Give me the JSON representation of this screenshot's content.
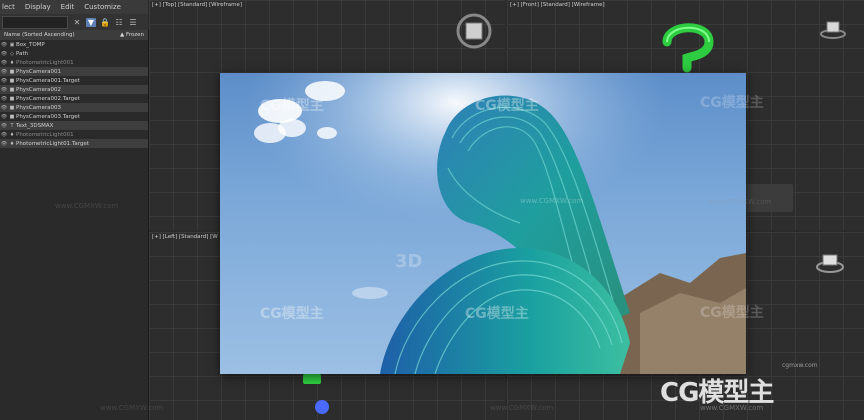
{
  "menu": [
    "lect",
    "Display",
    "Edit",
    "Customize"
  ],
  "explorer": {
    "header_name": "Name (Sorted Ascending)",
    "header_frozen": "▲ Frozen",
    "rows": [
      {
        "label": "Box_TOMP",
        "icon": "box-icon"
      },
      {
        "label": "Path",
        "icon": "shape-icon"
      },
      {
        "label": "PhotometricLight001",
        "icon": "light-icon"
      },
      {
        "label": "PhysCamera001",
        "icon": "camera-icon"
      },
      {
        "label": "PhysCamera001.Target",
        "icon": "camera-icon"
      },
      {
        "label": "PhysCamera002",
        "icon": "camera-icon"
      },
      {
        "label": "PhysCamera002.Target",
        "icon": "camera-icon"
      },
      {
        "label": "PhysCamera003",
        "icon": "camera-icon"
      },
      {
        "label": "PhysCamera003.Target",
        "icon": "camera-icon"
      },
      {
        "label": "Text_3DSMAX",
        "icon": "text-icon"
      },
      {
        "label": "PhotometricLight001",
        "icon": "light-icon"
      },
      {
        "label": "PhotometricLight01.Target",
        "icon": "light-icon"
      }
    ]
  },
  "viewports": {
    "top": "[+] [Top] [Standard] [Wireframe]",
    "front": "[+] [Front] [Standard] [Wireframe]",
    "left": "[+] [Left] [Standard] [W"
  },
  "watermarks": {
    "brand": "CG模型主",
    "url": "www.CGMXW.com",
    "url_small": "cgmxw.com",
    "faint": "3D"
  }
}
